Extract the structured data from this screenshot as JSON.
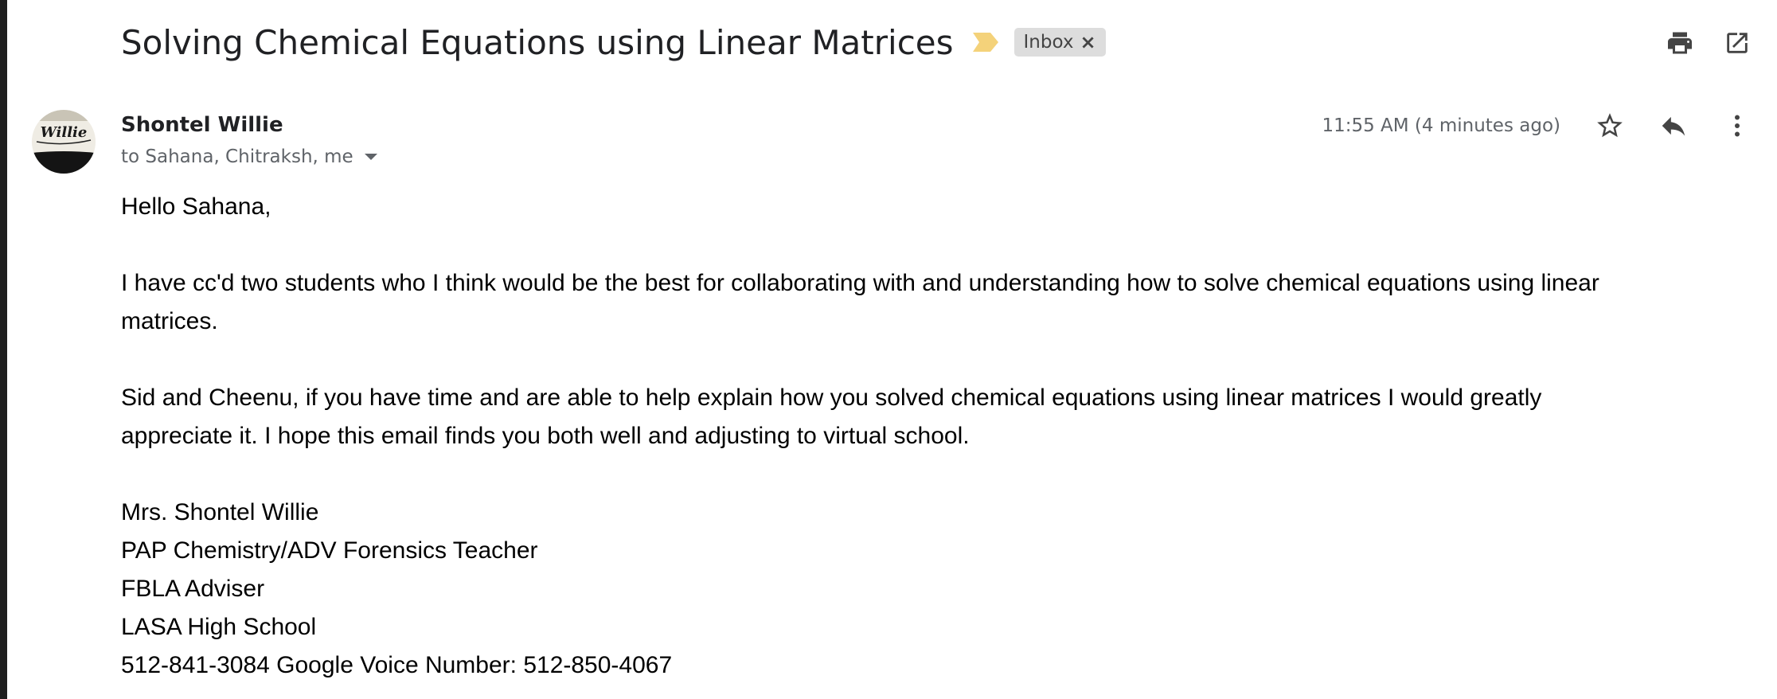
{
  "email": {
    "subject": "Solving Chemical Equations using Linear Matrices",
    "label": "Inbox",
    "label_close": "×",
    "sender": {
      "name": "Shontel Willie",
      "avatar_text": "Willie"
    },
    "recipients": "to Sahana, Chitraksh, me",
    "timestamp": "11:55 AM (4 minutes ago)",
    "body": {
      "greeting": "Hello Sahana,",
      "paragraph1_line1": "I have cc'd two students who I think would be the best for collaborating with and understanding how to solve chemical equations using linear",
      "paragraph1_line2": "matrices.",
      "paragraph2_line1": "Sid and Cheenu, if you have time and are able to help explain how you solved chemical equations using linear matrices I would greatly",
      "paragraph2_line2": "appreciate it.  I hope this email finds you both well and adjusting to virtual school.",
      "signature": [
        "Mrs. Shontel Willie",
        "PAP Chemistry/ADV Forensics Teacher",
        "FBLA Adviser",
        "LASA High School",
        "512-841-3084 Google Voice Number: 512-850-4067"
      ]
    }
  },
  "icons": {
    "importance": "importance-marker-icon",
    "print": "print-icon",
    "new_window": "open-in-new-window-icon",
    "star": "star-icon",
    "reply": "reply-icon",
    "more": "more-vertical-icon"
  },
  "colors": {
    "importance": "#f4d27a",
    "chip_bg": "#dddddd",
    "icon": "#444444",
    "meta_text": "#5f6368"
  }
}
